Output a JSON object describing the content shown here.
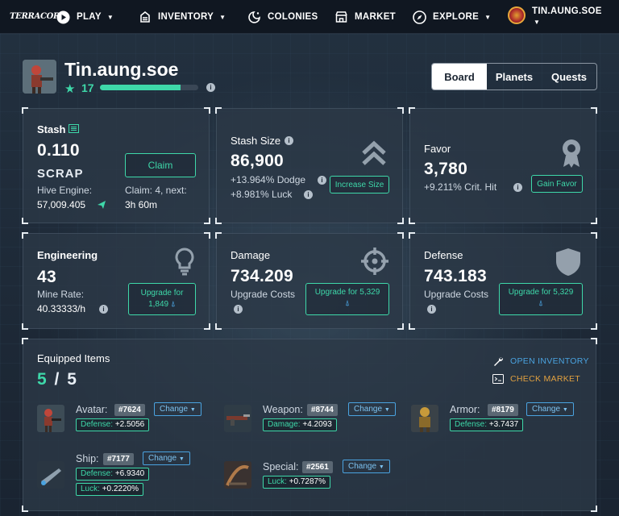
{
  "nav": {
    "logo": "TERRACORE",
    "items": [
      {
        "label": "PLAY",
        "icon": "play-icon",
        "has_caret": true
      },
      {
        "label": "INVENTORY",
        "icon": "inventory-icon",
        "has_caret": true
      },
      {
        "label": "COLONIES",
        "icon": "colonies-icon",
        "has_caret": false
      },
      {
        "label": "MARKET",
        "icon": "market-icon",
        "has_caret": false
      },
      {
        "label": "EXPLORE",
        "icon": "compass-icon",
        "has_caret": true
      }
    ],
    "user": "TIN.AUNG.SOE"
  },
  "profile": {
    "username": "Tin.aung.soe",
    "level": "17",
    "xp_fraction": 0.82
  },
  "tabs": [
    "Board",
    "Planets",
    "Quests"
  ],
  "active_tab": "Board",
  "stash": {
    "title": "Stash",
    "value": "0.110",
    "unit": "SCRAP",
    "hive_label": "Hive Engine:",
    "hive_value": "57,009.405",
    "claim_button": "Claim",
    "claim_label": "Claim: 4, next:",
    "claim_time": "3h 60m"
  },
  "stash_size": {
    "title": "Stash Size",
    "value": "86,900",
    "dodge": "+13.964% Dodge",
    "luck": "+8.981% Luck",
    "button": "Increase Size"
  },
  "favor": {
    "title": "Favor",
    "value": "3,780",
    "crit": "+9.211% Crit. Hit",
    "button": "Gain Favor"
  },
  "engineering": {
    "title": "Engineering",
    "value": "43",
    "rate_label": "Mine Rate:",
    "rate_value": "40.33333/h",
    "button_line1": "Upgrade for",
    "button_cost": "1,849"
  },
  "damage": {
    "title": "Damage",
    "value": "734.209",
    "costs_label": "Upgrade Costs",
    "button_line1": "Upgrade for 5,329"
  },
  "defense": {
    "title": "Defense",
    "value": "743.183",
    "costs_label": "Upgrade Costs",
    "button_line1": "Upgrade for 5,329"
  },
  "equipped": {
    "title": "Equipped Items",
    "count": "5",
    "slash": "/",
    "total": "5",
    "open_inventory": "OPEN INVENTORY",
    "check_market": "CHECK MARKET",
    "change_label": "Change",
    "items": [
      {
        "slot": "Avatar:",
        "id": "#7624",
        "stats": [
          {
            "k": "Defense:",
            "v": "+2.5056"
          }
        ]
      },
      {
        "slot": "Weapon:",
        "id": "#8744",
        "stats": [
          {
            "k": "Damage:",
            "v": "+4.2093"
          }
        ]
      },
      {
        "slot": "Armor:",
        "id": "#8179",
        "stats": [
          {
            "k": "Defense:",
            "v": "+3.7437"
          }
        ]
      },
      {
        "slot": "Ship:",
        "id": "#7177",
        "stats": [
          {
            "k": "Defense:",
            "v": "+6.9340"
          },
          {
            "k": "Luck:",
            "v": "+0.2220%"
          }
        ]
      },
      {
        "slot": "Special:",
        "id": "#2561",
        "stats": [
          {
            "k": "Luck:",
            "v": "+0.7287%"
          }
        ]
      }
    ]
  },
  "colors": {
    "accent": "#3ed8a9",
    "link_blue": "#4aa3e0",
    "market_orange": "#e0a040"
  }
}
